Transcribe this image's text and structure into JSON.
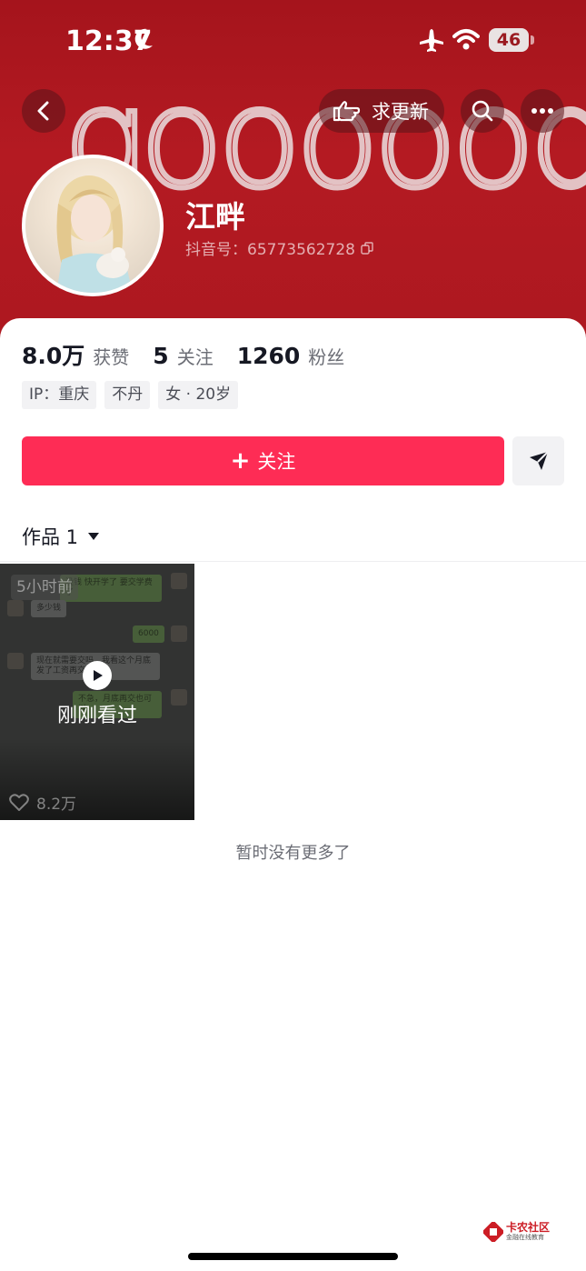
{
  "status_bar": {
    "time": "12:37",
    "battery": "46"
  },
  "banner": {
    "text": "goooood"
  },
  "nav": {
    "update_label": "求更新"
  },
  "profile": {
    "name": "江畔",
    "douyin_id": "抖音号：65773562728",
    "stats": [
      {
        "value": "8.0万",
        "label": "获赞"
      },
      {
        "value": "5",
        "label": "关注"
      },
      {
        "value": "1260",
        "label": "粉丝"
      }
    ],
    "tags": [
      "IP：重庆",
      "不丹",
      "女 · 20岁"
    ]
  },
  "actions": {
    "follow_label": "关注"
  },
  "works": {
    "tab_label": "作品 1"
  },
  "video": {
    "time_badge": "5小时前",
    "recent_label": "刚刚看过",
    "likes": "8.2万",
    "chat": {
      "line1": "没钱 快开学了 要交学费了",
      "line2": "多少钱",
      "line3": "6000",
      "line4": "现在就需要交吗，我看这个月底发了工资再交行吗",
      "line5": "不急，月底再交也可以"
    }
  },
  "footer": {
    "no_more": "暂时没有更多了"
  },
  "watermark": {
    "title": "卡农社区",
    "subtitle": "金融在线教育"
  },
  "colors": {
    "banner": "#ad1820",
    "follow": "#fe2c55"
  }
}
